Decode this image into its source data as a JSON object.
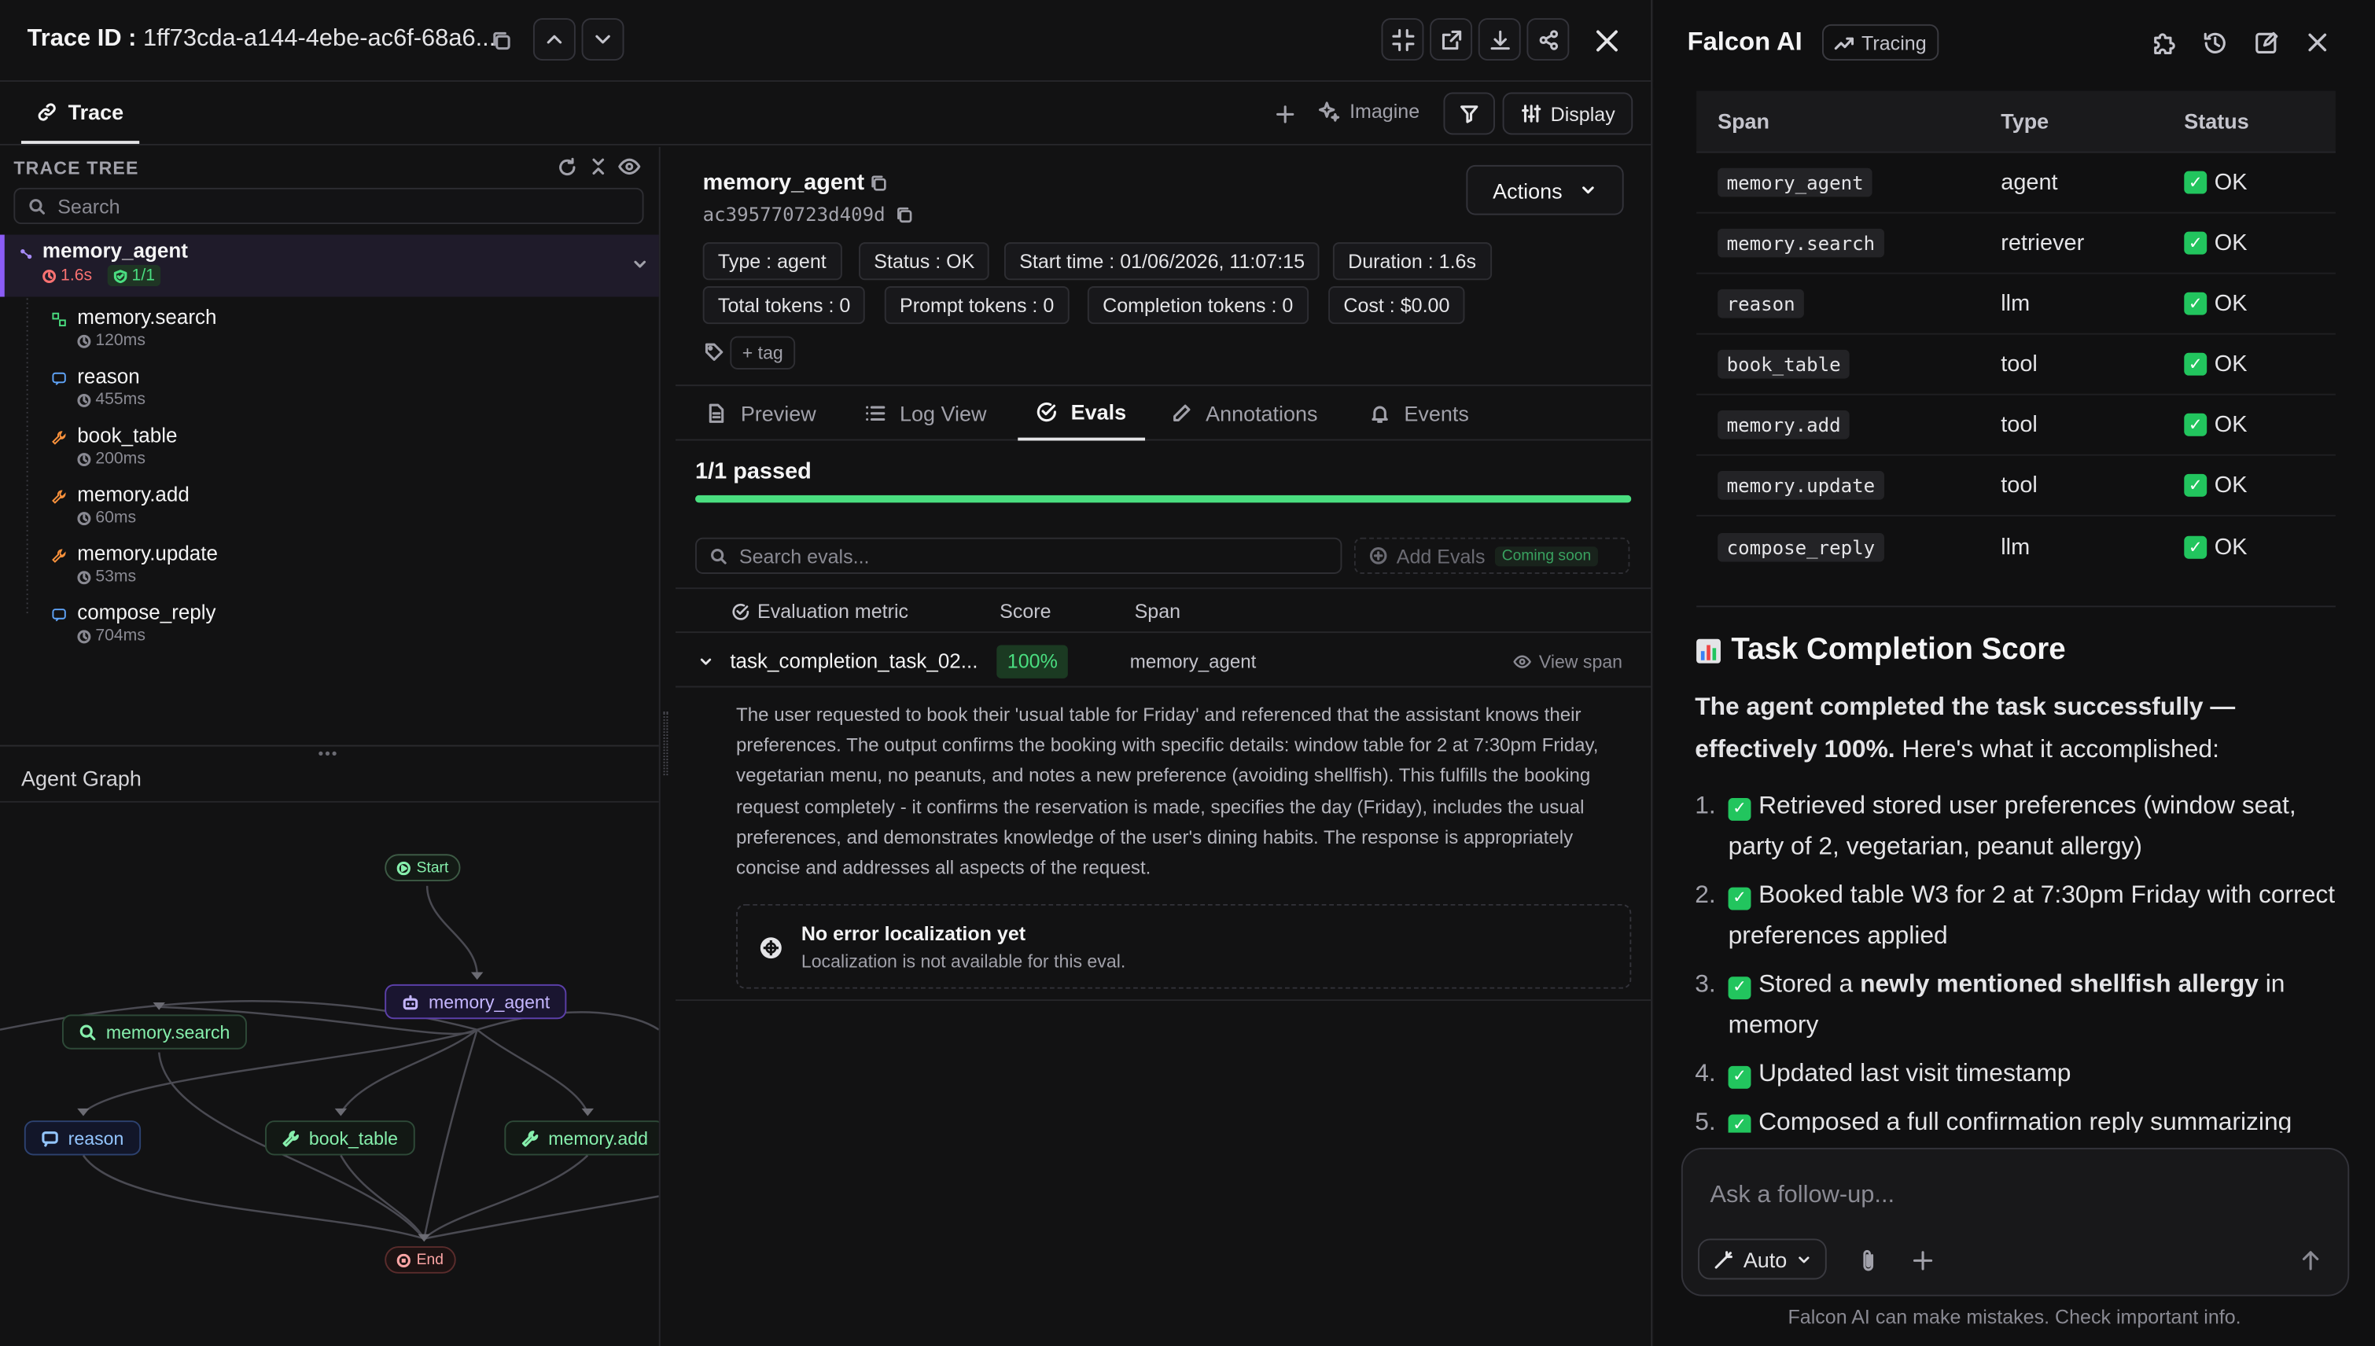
{
  "header": {
    "trace_id_label": "Trace ID : ",
    "trace_id_value": "1ff73cda-a144-4ebe-ac6f-68a6..."
  },
  "tabs": {
    "trace": "Trace",
    "imagine": "Imagine",
    "display": "Display"
  },
  "tree": {
    "title": "TRACE TREE",
    "search_placeholder": "Search",
    "root": {
      "name": "memory_agent",
      "duration": "1.6s",
      "evals": "1/1"
    },
    "children": [
      {
        "name": "memory.search",
        "duration": "120ms",
        "kind": "retriever"
      },
      {
        "name": "reason",
        "duration": "455ms",
        "kind": "llm"
      },
      {
        "name": "book_table",
        "duration": "200ms",
        "kind": "tool"
      },
      {
        "name": "memory.add",
        "duration": "60ms",
        "kind": "tool"
      },
      {
        "name": "memory.update",
        "duration": "53ms",
        "kind": "tool"
      },
      {
        "name": "compose_reply",
        "duration": "704ms",
        "kind": "llm"
      }
    ]
  },
  "graph": {
    "title": "Agent Graph",
    "nodes": {
      "start": "Start",
      "agent": "memory_agent",
      "search": "memory.search",
      "reason": "reason",
      "book": "book_table",
      "add": "memory.add",
      "end": "End"
    }
  },
  "detail": {
    "span_name": "memory_agent",
    "span_id": "ac395770723d409d",
    "actions": "Actions",
    "chips": {
      "type": "Type : agent",
      "status": "Status : OK",
      "start": "Start time : 01/06/2026, 11:07:15",
      "duration": "Duration : 1.6s",
      "total_tokens": "Total tokens : 0",
      "prompt_tokens": "Prompt tokens : 0",
      "completion_tokens": "Completion tokens : 0",
      "cost": "Cost : $0.00"
    },
    "tag": "+ tag",
    "tabs": {
      "preview": "Preview",
      "log": "Log View",
      "evals": "Evals",
      "annotations": "Annotations",
      "events": "Events"
    },
    "evals": {
      "passed": "1/1 passed",
      "pass_fraction": 1.0,
      "search_placeholder": "Search evals...",
      "add_evals": "Add Evals",
      "coming_soon": "Coming soon",
      "columns": {
        "metric": "Evaluation metric",
        "score": "Score",
        "span": "Span"
      },
      "row": {
        "metric": "task_completion_task_02...",
        "score": "100%",
        "span": "memory_agent",
        "view_span": "View span"
      },
      "explanation": "The user requested to book their 'usual table for Friday' and referenced that the assistant knows their preferences. The output confirms the booking with specific details: window table for 2 at 7:30pm Friday, vegetarian menu, no peanuts, and notes a new preference (avoiding shellfish). This fulfills the booking request completely - it confirms the reservation is made, specifies the day (Friday), includes the usual preferences, and demonstrates knowledge of the user's dining habits. The response is appropriately concise and addresses all aspects of the request.",
      "error_title": "No error localization yet",
      "error_sub": "Localization is not available for this eval."
    }
  },
  "falcon": {
    "title": "Falcon AI",
    "badge": "Tracing",
    "table": {
      "columns": {
        "span": "Span",
        "type": "Type",
        "status": "Status"
      },
      "rows": [
        {
          "span": "memory_agent",
          "type": "agent",
          "status": "OK"
        },
        {
          "span": "memory.search",
          "type": "retriever",
          "status": "OK"
        },
        {
          "span": "reason",
          "type": "llm",
          "status": "OK"
        },
        {
          "span": "book_table",
          "type": "tool",
          "status": "OK"
        },
        {
          "span": "memory.add",
          "type": "tool",
          "status": "OK"
        },
        {
          "span": "memory.update",
          "type": "tool",
          "status": "OK"
        },
        {
          "span": "compose_reply",
          "type": "llm",
          "status": "OK"
        }
      ]
    },
    "score_title": "Task Completion Score",
    "summary_bold": "The agent completed the task successfully — effectively 100%.",
    "summary_rest": " Here's what it accomplished:",
    "items": [
      {
        "num": "1.",
        "pre": "Retrieved stored user preferences (window seat, party of 2, vegetarian, peanut allergy)",
        "bold": "",
        "post": ""
      },
      {
        "num": "2.",
        "pre": "Booked table W3 for 2 at 7:30pm Friday with correct preferences applied",
        "bold": "",
        "post": ""
      },
      {
        "num": "3.",
        "pre": "Stored a ",
        "bold": "newly mentioned shellfish allergy",
        "post": " in memory"
      },
      {
        "num": "4.",
        "pre": "Updated last visit timestamp",
        "bold": "",
        "post": ""
      },
      {
        "num": "5.",
        "pre": "Composed a full confirmation reply summarizing",
        "bold": "",
        "post": ""
      }
    ],
    "followup_placeholder": "Ask a follow-up...",
    "mode": "Auto",
    "disclaimer": "Falcon AI can make mistakes. Check important info."
  }
}
